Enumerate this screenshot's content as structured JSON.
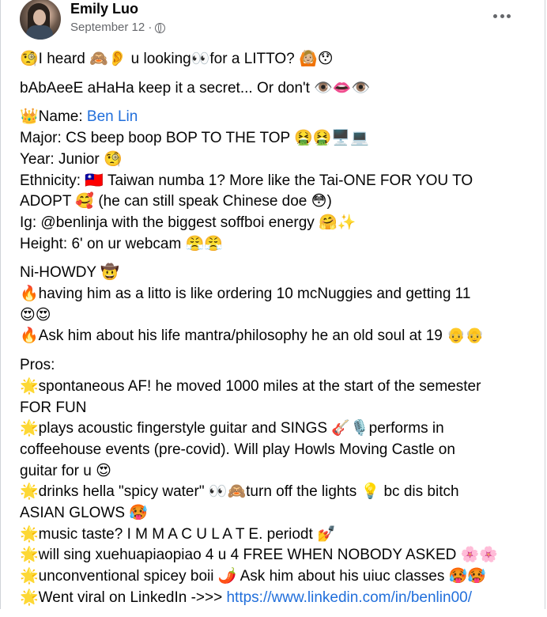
{
  "post": {
    "author": "Emily Luo",
    "date": "September 12 ·",
    "privacy_icon": "public-globe-icon",
    "more_icon": "more-options-icon"
  },
  "body": {
    "intro1": "🧐I heard 🙈👂 u looking👀for a LITTO? 🙆🏼😯",
    "intro2": "bAbAeeE aHaHa keep it a secret... Or don't 👁️👄👁️",
    "info": {
      "name_prefix": "👑Name: ",
      "name_value": "Ben Lin",
      "major": "Major: CS beep boop BOP TO THE TOP 🤮🤮🖥️💻",
      "year": "Year: Junior 🧐",
      "ethnicity_1": "Ethnicity: 🇹🇼 Taiwan numba 1? More like the Tai-ONE FOR YOU TO",
      "ethnicity_2": "ADOPT 🥰 (he can still speak Chinese doe 😳)",
      "ig": "Ig: @benlinja with the biggest soffboi energy 🤗✨",
      "height": "Height: 6' on ur webcam 😤😤"
    },
    "howdy": {
      "l1": "Ni-HOWDY 🤠",
      "l2": "🔥having him as a litto is like ordering 10 mcNuggies and getting 11",
      "l3": "😍😍",
      "l4": "🔥Ask him about his life mantra/philosophy he an old soul at 19 👴👴"
    },
    "pros": {
      "title": "Pros:",
      "l1": "🌟spontaneous AF! he moved 1000 miles at the start of the semester",
      "l2": "FOR FUN",
      "l3": "🌟plays acoustic fingerstyle guitar and SINGS 🎸🎙️performs in",
      "l4": "coffeehouse events (pre-covid). Will play Howls Moving Castle on",
      "l5": "guitar for u 😍",
      "l6": "🌟drinks hella \"spicy water\" 👀🙈turn off the lights 💡 bc dis bitch",
      "l7": "ASIAN GLOWS 🥵",
      "l8": "🌟music taste? I M M A C U L A T E. periodt 💅",
      "l9": "🌟will sing xuehuapiaopiao 4 u 4 FREE WHEN NOBODY ASKED 🌸🌸",
      "l10": "🌟unconventional spicey boii 🌶️ Ask him about his uiuc classes 🥵🥵",
      "l11_prefix": "🌟Went viral on LinkedIn ->>> ",
      "l11_link": "https://www.linkedin.com/in/benlin00/"
    }
  }
}
